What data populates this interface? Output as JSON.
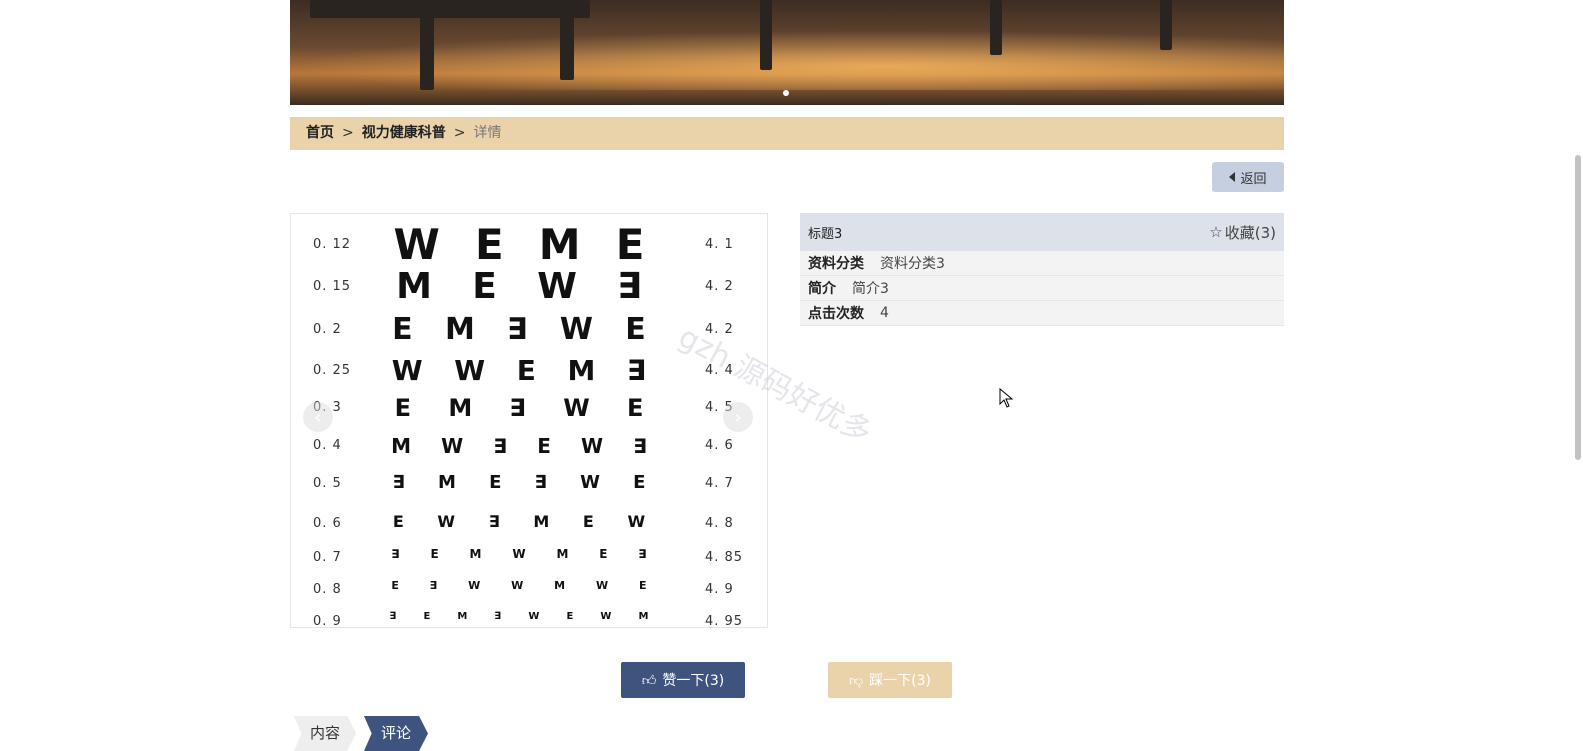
{
  "breadcrumb": {
    "home": "首页",
    "category": "视力健康科普",
    "current": "详情",
    "separator": ">"
  },
  "back_button": {
    "label": "返回",
    "icon": "caret-left-icon"
  },
  "eye_chart": {
    "rows": [
      {
        "left": "0. 12",
        "right": "4. 1",
        "letters": [
          "W",
          "E",
          "M",
          "E"
        ]
      },
      {
        "left": "0. 15",
        "right": "4. 2",
        "letters": [
          "M",
          "E",
          "W",
          "∃"
        ]
      },
      {
        "left": "0. 2",
        "right": "4. 2",
        "letters": [
          "E",
          "M",
          "∃",
          "W",
          "E"
        ]
      },
      {
        "left": "0. 25",
        "right": "4. 4",
        "letters": [
          "W",
          "W",
          "E",
          "M",
          "∃"
        ]
      },
      {
        "left": "0. 3",
        "right": "4. 5",
        "letters": [
          "E",
          "M",
          "∃",
          "W",
          "E"
        ]
      },
      {
        "left": "0. 4",
        "right": "4. 6",
        "letters": [
          "M",
          "W",
          "∃",
          "E",
          "W",
          "∃"
        ]
      },
      {
        "left": "0. 5",
        "right": "4. 7",
        "letters": [
          "∃",
          "M",
          "E",
          "∃",
          "W",
          "E"
        ]
      },
      {
        "left": "0. 6",
        "right": "4. 8",
        "letters": [
          "E",
          "W",
          "∃",
          "M",
          "E",
          "W"
        ]
      },
      {
        "left": "0. 7",
        "right": "4. 85",
        "letters": [
          "∃",
          "E",
          "M",
          "W",
          "M",
          "E",
          "∃"
        ]
      },
      {
        "left": "0. 8",
        "right": "4. 9",
        "letters": [
          "E",
          "∃",
          "W",
          "W",
          "M",
          "W",
          "E"
        ]
      },
      {
        "left": "0. 9",
        "right": "4. 95",
        "letters": [
          "∃",
          "E",
          "M",
          "∃",
          "W",
          "E",
          "W",
          "M"
        ]
      }
    ],
    "prev_icon": "chevron-left-icon",
    "next_icon": "chevron-right-icon"
  },
  "detail": {
    "title": "标题3",
    "favorite_label": "收藏(3)",
    "favorite_icon": "star-outline-icon",
    "fields": [
      {
        "key": "资料分类",
        "value": "资料分类3"
      },
      {
        "key": "简介",
        "value": "简介3"
      },
      {
        "key": "点击次数",
        "value": "4"
      }
    ]
  },
  "watermark": "gzh 源码好优多",
  "actions": {
    "like_label": "赞一下(3)",
    "dislike_label": "踩一下(3)"
  },
  "tabs": [
    {
      "label": "内容",
      "active": false
    },
    {
      "label": "评论",
      "active": true
    }
  ],
  "colors": {
    "accent": "#3e547f",
    "beige": "#ead2aa",
    "panel_head": "#dde1ea",
    "back_button": "#c6cfe0"
  }
}
